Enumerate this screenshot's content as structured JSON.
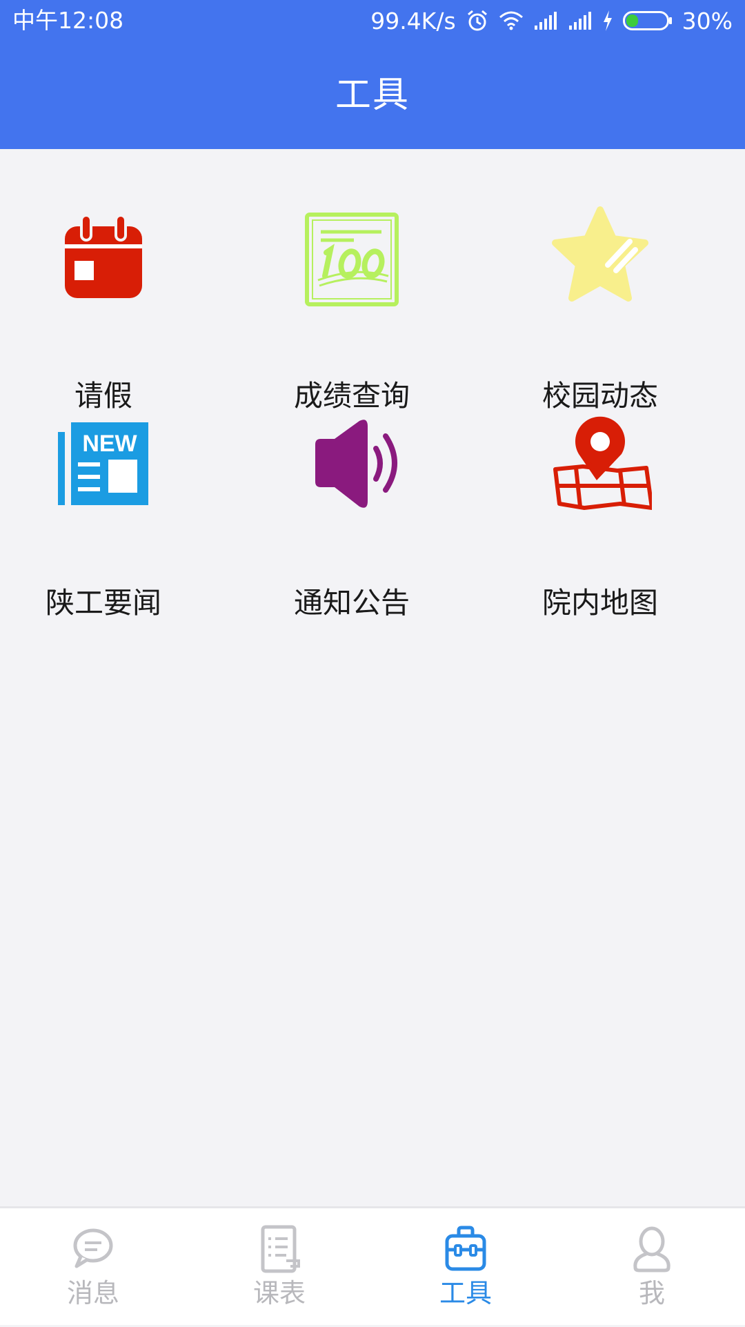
{
  "status_bar": {
    "time": "中午12:08",
    "network_speed": "99.4K/s",
    "battery_percent": "30%",
    "battery_level": 0.3,
    "icons": [
      "alarm-icon",
      "wifi-icon",
      "signal-icon",
      "signal-icon",
      "charging-icon",
      "battery-icon"
    ]
  },
  "header": {
    "title": "工具"
  },
  "tools": [
    {
      "label": "请假",
      "icon": "calendar-icon",
      "color": "#d81e06"
    },
    {
      "label": "成绩查询",
      "icon": "score-100-icon",
      "color": "#b6f05e"
    },
    {
      "label": "校园动态",
      "icon": "star-icon",
      "color": "#f8ef8c"
    },
    {
      "label": "陕工要闻",
      "icon": "newspaper-icon",
      "color": "#1b9ce2",
      "icon_text": "NEW"
    },
    {
      "label": "通知公告",
      "icon": "speaker-icon",
      "color": "#8a1a7e"
    },
    {
      "label": "院内地图",
      "icon": "map-pin-icon",
      "color": "#d81e06"
    }
  ],
  "tab_bar": {
    "items": [
      {
        "label": "消息",
        "icon": "chat-bubble-icon"
      },
      {
        "label": "课表",
        "icon": "schedule-icon"
      },
      {
        "label": "工具",
        "icon": "toolbox-icon",
        "active": true
      },
      {
        "label": "我",
        "icon": "user-icon"
      }
    ],
    "active_color": "#2a8ae6",
    "inactive_color": "#b8b8bc"
  },
  "colors": {
    "primary": "#4374ee",
    "background": "#f3f3f6"
  }
}
